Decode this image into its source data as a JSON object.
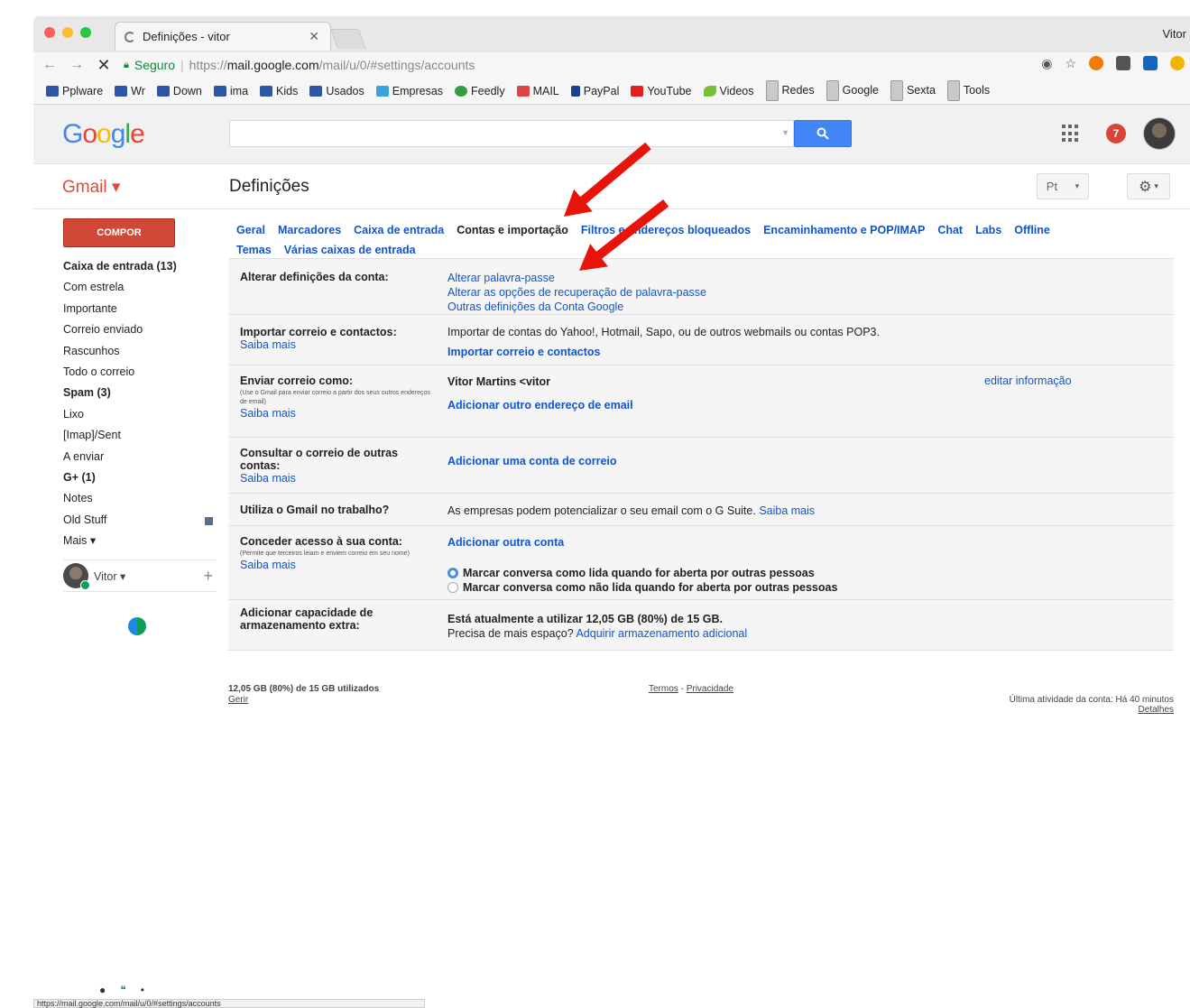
{
  "browser": {
    "tab_title": "Definições - vitor",
    "profile": "Vitor",
    "secure_label": "Seguro",
    "url_scheme": "https://",
    "url_host": "mail.google.com",
    "url_path": "/mail/u/0/#settings/accounts",
    "bookmarks": [
      {
        "label": "Pplware",
        "icon": "doc"
      },
      {
        "label": "Wr",
        "icon": "doc"
      },
      {
        "label": "Down",
        "icon": "doc"
      },
      {
        "label": "ima",
        "icon": "doc"
      },
      {
        "label": "Kids",
        "icon": "doc"
      },
      {
        "label": "Usados",
        "icon": "doc"
      },
      {
        "label": "Empresas",
        "icon": "cyan"
      },
      {
        "label": "Feedly",
        "icon": "green"
      },
      {
        "label": "MAIL",
        "icon": "mail"
      },
      {
        "label": "PayPal",
        "icon": "pp"
      },
      {
        "label": "YouTube",
        "icon": "yt"
      },
      {
        "label": "Videos",
        "icon": "leaf"
      },
      {
        "label": "Redes",
        "icon": "folder"
      },
      {
        "label": "Google",
        "icon": "folder"
      },
      {
        "label": "Sexta",
        "icon": "folder"
      },
      {
        "label": "Tools",
        "icon": "folder"
      }
    ],
    "status_url": "https://mail.google.com/mail/u/0/#settings/accounts"
  },
  "google": {
    "notification_count": "7"
  },
  "gmail": {
    "brand": "Gmail ▾",
    "page_title": "Definições",
    "lang_button": "Pt",
    "compose": "COMPOR",
    "folders": [
      {
        "label": "Caixa de entrada (13)",
        "bold": true
      },
      {
        "label": "Com estrela",
        "bold": false
      },
      {
        "label": "Importante",
        "bold": false
      },
      {
        "label": "Correio enviado",
        "bold": false
      },
      {
        "label": "Rascunhos",
        "bold": false
      },
      {
        "label": "Todo o correio",
        "bold": false
      },
      {
        "label": "Spam (3)",
        "bold": true
      },
      {
        "label": "Lixo",
        "bold": false
      },
      {
        "label": "[Imap]/Sent",
        "bold": false
      },
      {
        "label": "A enviar",
        "bold": false
      },
      {
        "label": "G+ (1)",
        "bold": true
      },
      {
        "label": "Notes",
        "bold": false
      },
      {
        "label": "Old Stuff",
        "bold": false
      },
      {
        "label": "Mais ▾",
        "bold": false
      }
    ],
    "chat_user": "Vitor ▾"
  },
  "settings": {
    "tabs_line1": [
      "Geral",
      "Marcadores",
      "Caixa de entrada",
      "Contas e importação",
      "Filtros e endereços bloqueados",
      "Encaminhamento e POP/IMAP",
      "Chat",
      "Labs",
      "Offline"
    ],
    "tabs_line2": [
      "Temas",
      "Várias caixas de entrada"
    ],
    "active_tab": "Contas e importação",
    "account": {
      "label": "Alterar definições da conta:",
      "links": [
        "Alterar palavra-passe",
        "Alterar as opções de recuperação de palavra-passe",
        "Outras definições da Conta Google"
      ]
    },
    "import": {
      "label": "Importar correio e contactos:",
      "learn": "Saiba mais",
      "desc": "Importar de contas do Yahoo!, Hotmail, Sapo, ou de outros webmails ou contas POP3.",
      "action": "Importar correio e contactos"
    },
    "sendas": {
      "label": "Enviar correio como:",
      "sub": "(Use o Gmail para enviar correio a partir dos seus outros endereços de email)",
      "learn": "Saiba mais",
      "address": "Vitor Martins <vitor",
      "edit": "editar informação",
      "action": "Adicionar outro endereço de email"
    },
    "check": {
      "label": "Consultar o correio de outras contas:",
      "learn": "Saiba mais",
      "action": "Adicionar uma conta de correio"
    },
    "work": {
      "label": "Utiliza o Gmail no trabalho?",
      "desc": "As empresas podem potencializar o seu email com o G Suite.",
      "learn": "Saiba mais"
    },
    "grant": {
      "label": "Conceder acesso à sua conta:",
      "sub": "(Permite que terceiros leiam e enviem correio em seu nome)",
      "learn": "Saiba mais",
      "action": "Adicionar outra conta",
      "option1": "Marcar conversa como lida quando for aberta por outras pessoas",
      "option2": "Marcar conversa como não lida quando for aberta por outras pessoas"
    },
    "storage": {
      "label": "Adicionar capacidade de armazenamento extra:",
      "line1": "Está atualmente a utilizar 12,05 GB (80%) de 15 GB.",
      "line2": "Precisa de mais espaço?",
      "action": "Adquirir armazenamento adicional"
    }
  },
  "footer": {
    "usage": "12,05 GB (80%) de 15 GB utilizados",
    "manage": "Gerir",
    "terms": "Termos",
    "sep": " - ",
    "privacy": "Privacidade",
    "activity": "Última atividade da conta: Há 40 minutos",
    "details": "Detalhes"
  },
  "colors": {
    "gmail_red": "#dd4b39",
    "compose_red": "#d14836",
    "link_blue": "#1155cc",
    "search_blue": "#4285f4",
    "arrow_red": "#e8140c"
  }
}
